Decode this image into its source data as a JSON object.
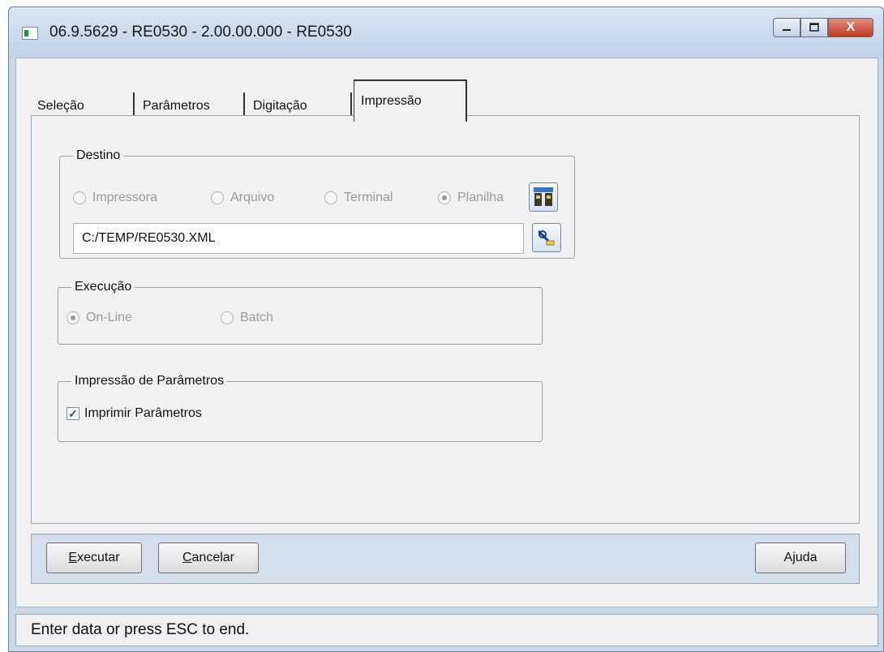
{
  "window": {
    "title": "06.9.5629 - RE0530 - 2.00.00.000 - RE0530",
    "minimize_icon": "minimize-icon",
    "maximize_icon": "maximize-icon",
    "close_icon": "close-icon",
    "close_label": "X"
  },
  "tabs": [
    {
      "label": "Seleção",
      "active": false
    },
    {
      "label": "Parâmetros",
      "active": false
    },
    {
      "label": "Digitação",
      "active": false
    },
    {
      "label": "Impressão",
      "active": true
    }
  ],
  "destino": {
    "legend": "Destino",
    "options": [
      {
        "label": "Impressora",
        "selected": false
      },
      {
        "label": "Arquivo",
        "selected": false
      },
      {
        "label": "Terminal",
        "selected": false
      },
      {
        "label": "Planilha",
        "selected": true
      }
    ],
    "config_icon": "spreadsheet-config-icon",
    "path_value": "C:/TEMP/RE0530.XML",
    "browse_icon": "file-browse-icon"
  },
  "execucao": {
    "legend": "Execução",
    "options": [
      {
        "label": "On-Line",
        "selected": true
      },
      {
        "label": "Batch",
        "selected": false
      }
    ]
  },
  "impressao_parametros": {
    "legend": "Impressão de Parâmetros",
    "checkbox_label": "Imprimir Parâmetros",
    "checked": true,
    "check_glyph": "✓"
  },
  "buttons": {
    "execute_first": "E",
    "execute_rest": "xecutar",
    "cancel_first": "C",
    "cancel_rest": "ancelar",
    "help_first": "A",
    "help_mid": "j",
    "help_rest": "uda"
  },
  "status_text": "Enter data or press ESC to end.",
  "colors": {
    "title_bar": "#c9d9ea",
    "close_button": "#c0391f",
    "bottom_bar": "#d3dfec",
    "disabled_text": "#9a9a9a"
  }
}
